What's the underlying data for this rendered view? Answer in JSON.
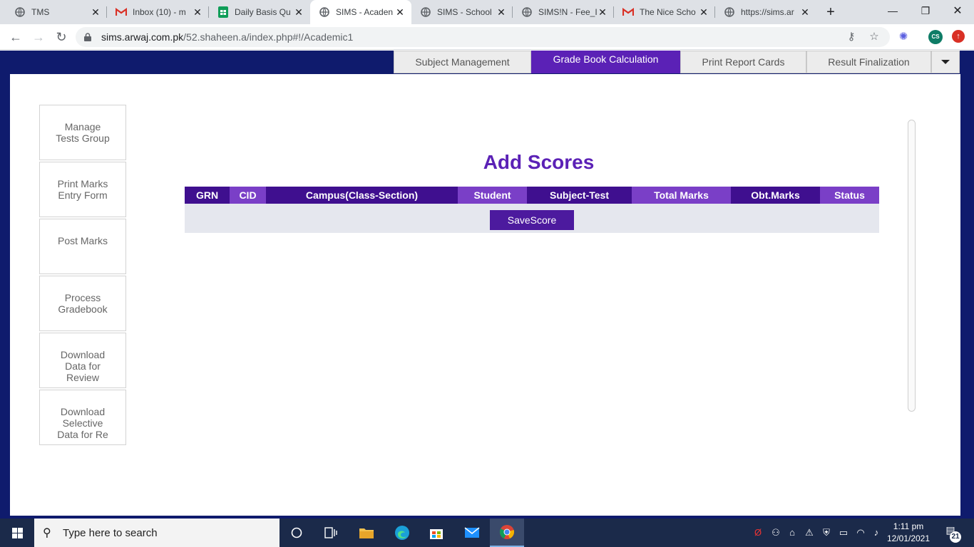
{
  "browser": {
    "tabs": [
      {
        "title": "TMS",
        "icon": "globe-icon",
        "active": false
      },
      {
        "title": "Inbox (10) - m",
        "icon": "gmail-icon",
        "active": false
      },
      {
        "title": "Daily Basis Qu",
        "icon": "sheets-icon",
        "active": false
      },
      {
        "title": "SIMS - Acaden",
        "icon": "globe-icon",
        "active": true
      },
      {
        "title": "SIMS - School",
        "icon": "globe-icon",
        "active": false
      },
      {
        "title": "SIMS!N - Fee_I",
        "icon": "globe-icon",
        "active": false
      },
      {
        "title": "The Nice Scho",
        "icon": "gmail-icon",
        "active": false
      },
      {
        "title": "https://sims.ar",
        "icon": "globe-icon",
        "active": false
      }
    ],
    "url_domain": "sims.arwaj.com.pk",
    "url_path": "/52.shaheen.a/index.php#!/Academic1",
    "profile_initials": "CS"
  },
  "topnav": {
    "tabs": [
      "Subject Management",
      "Grade Book Calculation",
      "Print Report Cards",
      "Result Finalization"
    ],
    "active": "Grade Book Calculation"
  },
  "sidebar": {
    "items": [
      {
        "lines": [
          "Manage",
          "Tests Group"
        ]
      },
      {
        "lines": [
          "Print Marks",
          "Entry Form"
        ]
      },
      {
        "lines": [
          "Post Marks"
        ]
      },
      {
        "lines": [
          "Process",
          "Gradebook"
        ]
      },
      {
        "lines": [
          "Download",
          "Data for",
          "Review"
        ]
      },
      {
        "lines": [
          "Download",
          "Selective",
          "Data for Re"
        ]
      }
    ]
  },
  "main": {
    "heading": "Add Scores",
    "columns": [
      "GRN",
      "CID",
      "Campus(Class-Section)",
      "Student",
      "Subject-Test",
      "Total Marks",
      "Obt.Marks",
      "Status"
    ],
    "save_button": "SaveScore"
  },
  "taskbar": {
    "search_placeholder": "Type here to search",
    "time": "1:11 pm",
    "date": "12/01/2021",
    "notification_count": "21"
  },
  "colors": {
    "header_bg": "#0f1b6d",
    "accent": "#5b21b6",
    "column_dark": "#3f0f8f",
    "column_light": "#7a3fc7"
  }
}
